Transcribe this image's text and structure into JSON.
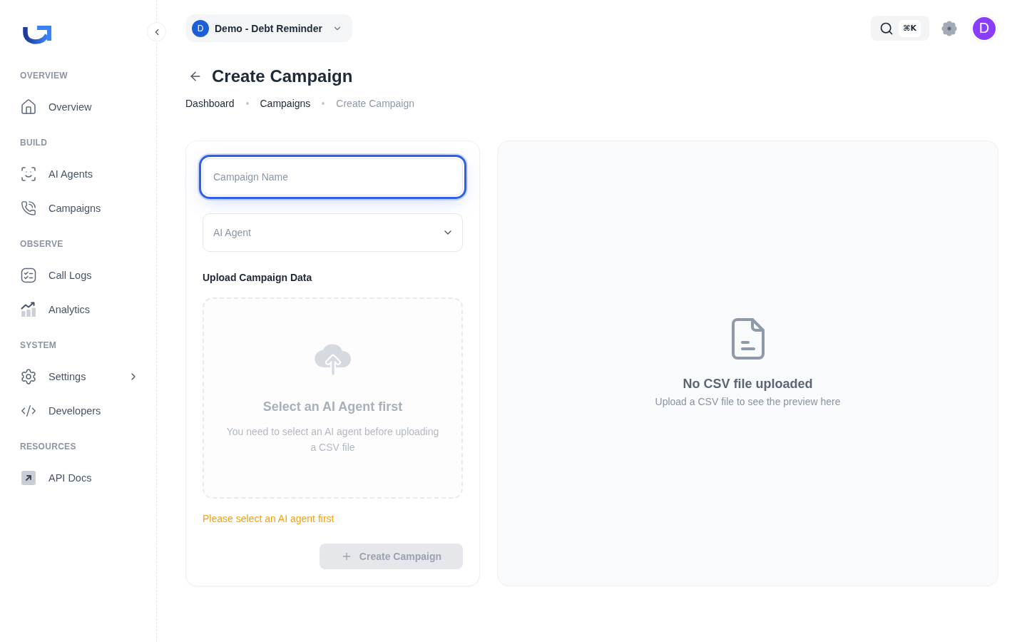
{
  "sidebar": {
    "sections": [
      {
        "title": "OVERVIEW",
        "items": [
          {
            "label": "Overview",
            "selected": false,
            "submenu": false
          }
        ]
      },
      {
        "title": "BUILD",
        "items": [
          {
            "label": "AI Agents",
            "selected": false,
            "submenu": false
          },
          {
            "label": "Campaigns",
            "selected": false,
            "submenu": false
          }
        ]
      },
      {
        "title": "OBSERVE",
        "items": [
          {
            "label": "Call Logs",
            "selected": false,
            "submenu": false
          },
          {
            "label": "Analytics",
            "selected": false,
            "submenu": false
          }
        ]
      },
      {
        "title": "SYSTEM",
        "items": [
          {
            "label": "Settings",
            "selected": false,
            "submenu": true
          },
          {
            "label": "Developers",
            "selected": false,
            "submenu": false
          }
        ]
      },
      {
        "title": "RESOURCES",
        "items": [
          {
            "label": "API Docs",
            "selected": false,
            "submenu": false
          }
        ]
      }
    ]
  },
  "topbar": {
    "workspace": {
      "initial": "D",
      "name": "Demo - Debt Reminder"
    },
    "search": {
      "shortcut": "⌘K"
    },
    "user": {
      "initial": "D"
    }
  },
  "page": {
    "title": "Create Campaign",
    "breadcrumbs": [
      {
        "label": "Dashboard",
        "current": false
      },
      {
        "label": "Campaigns",
        "current": false
      },
      {
        "label": "Create Campaign",
        "current": true
      }
    ]
  },
  "form": {
    "campaign_name": {
      "placeholder": "Campaign Name",
      "focused": true
    },
    "agent_select": {
      "placeholder": "AI Agent"
    },
    "upload": {
      "label": "Upload Campaign Data",
      "title": "Select an AI Agent first",
      "description": "You need to select an AI agent before uploading a CSV file",
      "disabled": true
    },
    "warning": "Please select an AI agent first",
    "submit": {
      "label": "Create Campaign",
      "disabled": true
    }
  },
  "preview": {
    "title": "No CSV file uploaded",
    "subtitle": "Upload a CSV file to see the preview here"
  }
}
